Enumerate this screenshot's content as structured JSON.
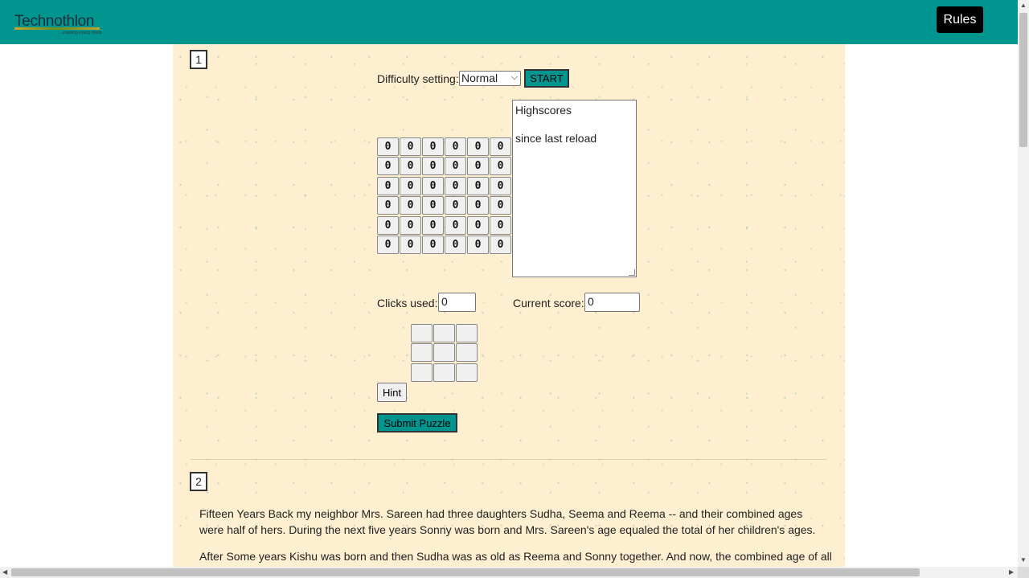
{
  "header": {
    "logo_text": "Technothlon",
    "logo_tagline": "...inspiring young minds",
    "rules_label": "Rules",
    "accent_color": "#00968f"
  },
  "question1": {
    "number": "1",
    "difficulty_label": "Difficulty setting:",
    "difficulty_value": "Normal",
    "start_label": "START",
    "highscores_title": "Highscores",
    "highscores_sub": "since last reload",
    "grid": [
      [
        "0",
        "0",
        "0",
        "0",
        "0",
        "0"
      ],
      [
        "0",
        "0",
        "0",
        "0",
        "0",
        "0"
      ],
      [
        "0",
        "0",
        "0",
        "0",
        "0",
        "0"
      ],
      [
        "0",
        "0",
        "0",
        "0",
        "0",
        "0"
      ],
      [
        "0",
        "0",
        "0",
        "0",
        "0",
        "0"
      ],
      [
        "0",
        "0",
        "0",
        "0",
        "0",
        "0"
      ]
    ],
    "clicks_label": "Clicks used:",
    "clicks_value": "0",
    "score_label": "Current score:",
    "score_value": "0",
    "hint_label": "Hint",
    "submit_label": "Submit Puzzle"
  },
  "question2": {
    "number": "2",
    "paragraph1": "Fifteen Years Back my neighbor Mrs. Sareen had three daughters Sudha, Seema and Reema -- and their combined ages were half of hers. During the next five years Sonny was born and Mrs. Sareen's age equaled the total of her children's ages.",
    "paragraph2": "After Some years Kishu was born and then Sudha was as old as Reema and Sonny together. And now, the combined age of all"
  }
}
